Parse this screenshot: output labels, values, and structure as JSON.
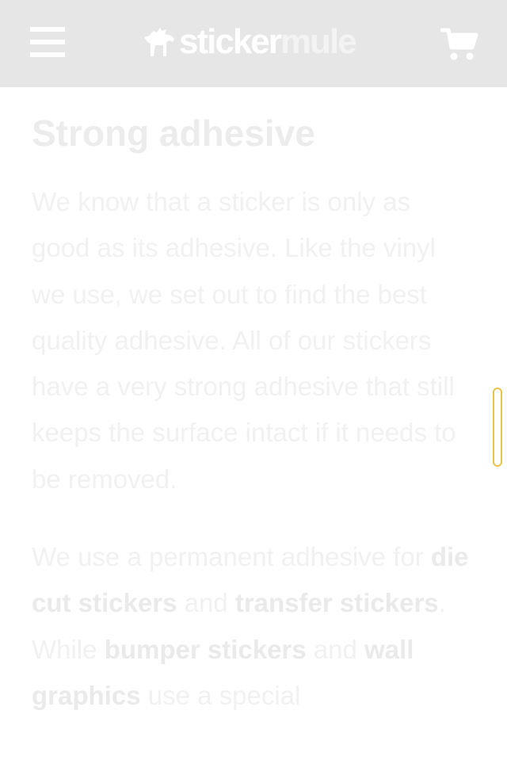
{
  "header": {
    "menu_icon": "hamburger-menu-icon",
    "logo_text_1": "sticker",
    "logo_text_2": "mule",
    "logo_icon": "mule-icon",
    "cart_icon": "cart-icon",
    "bg_color": "#e6e6e6"
  },
  "article": {
    "heading": "Strong adhesive",
    "paragraph1": "We know that a sticker is only as good as its adhesive. Like the vinyl we use, we set out to find the best quality adhesive. All of our stickers have a very strong adhesive that still keeps the surface intact if it needs to be removed.",
    "paragraph2": {
      "part1": "We use a permanent adhesive for ",
      "link1": "die cut stickers",
      "part2": " and ",
      "link2": "transfer stickers",
      "part3": ". While ",
      "link3": "bumper stickers",
      "part4": " and ",
      "link4": "wall graphics",
      "part5": " use a special"
    }
  }
}
